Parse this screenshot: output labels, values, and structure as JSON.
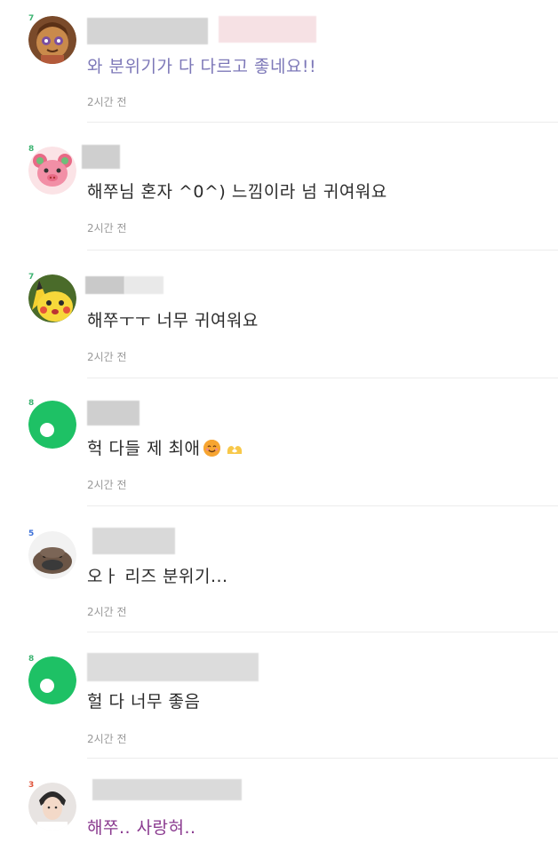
{
  "comments": [
    {
      "level": "7",
      "level_color": "#3cb371",
      "avatar": "cookie-character",
      "text": "와 분위기가 다 다르고 좋네요!!",
      "text_color": "#7d78b8",
      "time": "2시간 전"
    },
    {
      "level": "8",
      "level_color": "#3cb371",
      "avatar": "pink-pig-character",
      "text": "해쭈님 혼자 ^0^) 느낌이라 넘 귀여워요",
      "text_color": "#2b2b2b",
      "time": "2시간 전"
    },
    {
      "level": "7",
      "level_color": "#3cb371",
      "avatar": "pikachu-character",
      "text": "해쭈ㅜㅜ 너무 귀여워요",
      "text_color": "#2b2b2b",
      "time": "2시간 전"
    },
    {
      "level": "8",
      "level_color": "#3cb371",
      "avatar": "default-green-avatar",
      "text": "헉 다들 제 최애",
      "text_color": "#2b2b2b",
      "time": "2시간 전"
    },
    {
      "level": "5",
      "level_color": "#3b6fd8",
      "avatar": "platypus-photo",
      "text": "오ㅏ 리즈 분위기...",
      "text_color": "#2b2b2b",
      "time": "2시간 전"
    },
    {
      "level": "8",
      "level_color": "#3cb371",
      "avatar": "default-green-avatar",
      "text": "헐 다 너무 좋음",
      "text_color": "#2b2b2b",
      "time": "2시간 전"
    },
    {
      "level": "3",
      "level_color": "#e0533a",
      "avatar": "person-photo",
      "text": "해쭈.. 사랑혀..",
      "text_color": "#8a3a8f",
      "time": ""
    }
  ],
  "emoji": {
    "smile": "smiling-face-emoji",
    "hands": "heart-hands-emoji"
  }
}
